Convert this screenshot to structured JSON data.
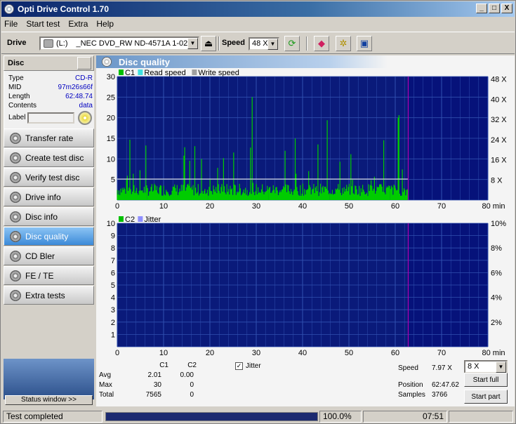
{
  "window": {
    "title": "Opti Drive Control 1.70",
    "buttons": [
      "_",
      "□",
      "X"
    ]
  },
  "menu": [
    "File",
    "Start test",
    "Extra",
    "Help"
  ],
  "toolbar": {
    "drive_label": "Drive",
    "drive_letter": "(L:)",
    "drive_name": "_NEC DVD_RW ND-4571A 1-02",
    "speed_label": "Speed",
    "speed_value": "48 X"
  },
  "disc": {
    "header": "Disc",
    "fields": [
      {
        "k": "Type",
        "v": "CD-R"
      },
      {
        "k": "MID",
        "v": "97m26s66f"
      },
      {
        "k": "Length",
        "v": "62:48.74"
      },
      {
        "k": "Contents",
        "v": "data"
      }
    ],
    "label_key": "Label"
  },
  "nav": [
    {
      "label": "Transfer rate",
      "active": false
    },
    {
      "label": "Create test disc",
      "active": false
    },
    {
      "label": "Verify test disc",
      "active": false
    },
    {
      "label": "Drive info",
      "active": false
    },
    {
      "label": "Disc info",
      "active": false
    },
    {
      "label": "Disc quality",
      "active": true
    },
    {
      "label": "CD Bler",
      "active": false
    },
    {
      "label": "FE / TE",
      "active": false
    },
    {
      "label": "Extra tests",
      "active": false
    }
  ],
  "status_window_btn": "Status window >>",
  "main_title": "Disc quality",
  "chart_data": [
    {
      "type": "bar",
      "legend": [
        "C1",
        "Read speed",
        "Write speed"
      ],
      "legend_colors": [
        "#00c000",
        "#40e0e0",
        "#a0a0a0"
      ],
      "x_ticks": [
        "0",
        "10",
        "20",
        "30",
        "40",
        "50",
        "60",
        "70",
        "80 min"
      ],
      "y_ticks_left": [
        "5",
        "10",
        "15",
        "20",
        "25",
        "30"
      ],
      "y_ticks_right": [
        "8 X",
        "16 X",
        "24 X",
        "32 X",
        "40 X",
        "48 X"
      ],
      "xlim": [
        0,
        80
      ],
      "ylim": [
        0,
        30
      ],
      "disc_end_min": 62.8,
      "series_note": "C1 errors per second",
      "c1_avg": 2.01,
      "c1_max": 30,
      "speed_line_x": 8
    },
    {
      "type": "bar",
      "legend": [
        "C2",
        "Jitter"
      ],
      "legend_colors": [
        "#00c000",
        "#9090ff"
      ],
      "x_ticks": [
        "0",
        "10",
        "20",
        "30",
        "40",
        "50",
        "60",
        "70",
        "80 min"
      ],
      "y_ticks_left": [
        "1",
        "2",
        "3",
        "4",
        "5",
        "6",
        "7",
        "8",
        "9",
        "10"
      ],
      "y_ticks_right": [
        "2%",
        "4%",
        "6%",
        "8%",
        "10%"
      ],
      "xlim": [
        0,
        80
      ],
      "ylim": [
        0,
        10
      ],
      "disc_end_min": 62.8
    }
  ],
  "stats": {
    "col_c1": "C1",
    "col_c2": "C2",
    "rows": [
      {
        "k": "Avg",
        "c1": "2.01",
        "c2": "0.00"
      },
      {
        "k": "Max",
        "c1": "30",
        "c2": "0"
      },
      {
        "k": "Total",
        "c1": "7565",
        "c2": "0"
      }
    ],
    "jitter_label": "Jitter",
    "speed_label": "Speed",
    "speed_value": "7.97 X",
    "speed_select": "8 X",
    "position_label": "Position",
    "position_value": "62:47.62",
    "samples_label": "Samples",
    "samples_value": "3766",
    "start_full": "Start full",
    "start_part": "Start part"
  },
  "statusbar": {
    "text": "Test completed",
    "percent": "100.0%",
    "time": "07:51",
    "progress": 1.0
  },
  "colors": {
    "plot_bg": "#0a1a7a",
    "grid": "#3050b0",
    "c1": "#00cc00",
    "end_marker": "#b000b0"
  }
}
